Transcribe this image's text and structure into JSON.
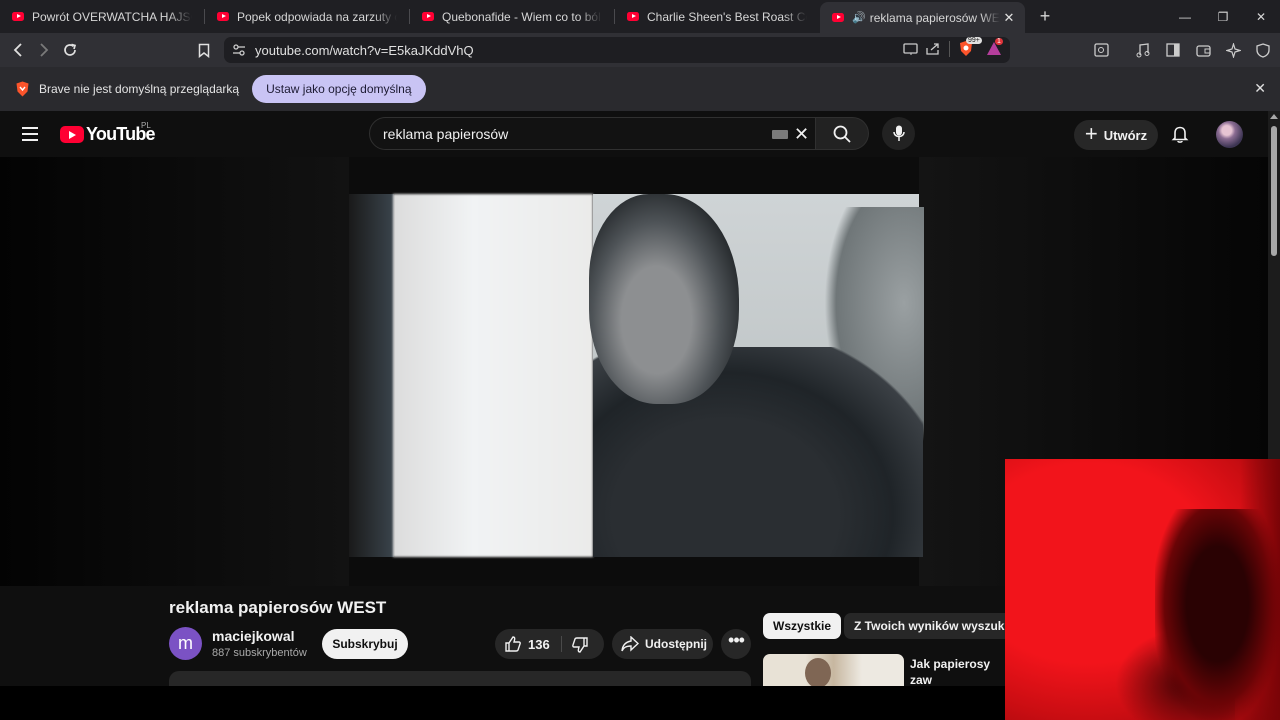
{
  "browser": {
    "tabs": [
      {
        "title": "Powrót OVERWATCHA HAJSOWNIKÓW",
        "active": false,
        "audio": false
      },
      {
        "title": "Popek odpowiada na zarzuty o zoofilię",
        "active": false,
        "audio": false
      },
      {
        "title": "Quebonafide - Wiem co to ból (FT. Kękę)",
        "active": false,
        "audio": false
      },
      {
        "title": "Charlie Sheen's Best Roast Comebacks",
        "active": false,
        "audio": false
      },
      {
        "title": "reklama papierosów WEST - YouTube",
        "active": true,
        "audio": true
      }
    ],
    "url": "youtube.com/watch?v=E5kaJKddVhQ",
    "shields_badge": "99+",
    "rewards_badge": "1",
    "infobar": {
      "message": "Brave nie jest domyślną przeglądarką",
      "button": "Ustaw jako opcję domyślną"
    }
  },
  "youtube": {
    "logo_text": "YouTube",
    "country_code": "PL",
    "search_query": "reklama papierosów",
    "create_label": "Utwórz",
    "video": {
      "title": "reklama papierosów WEST",
      "channel": "maciejkowal",
      "channel_initial": "m",
      "subscribers": "887 subskrybentów",
      "subscribe_label": "Subskrybuj",
      "likes": "136",
      "share_label": "Udostępnij",
      "more_label": "•••"
    },
    "chips": [
      "Wszystkie",
      "Z Twoich wyników wyszukiwania"
    ],
    "recommended": [
      {
        "title": "Jak papierosy zaw\nświatem? Reklamy"
      }
    ]
  },
  "colors": {
    "accent": "#ff0033",
    "infobar_button": "#c9c4f4",
    "channel_avatar": "#7b52c4",
    "pip_red": "#f2141b"
  }
}
